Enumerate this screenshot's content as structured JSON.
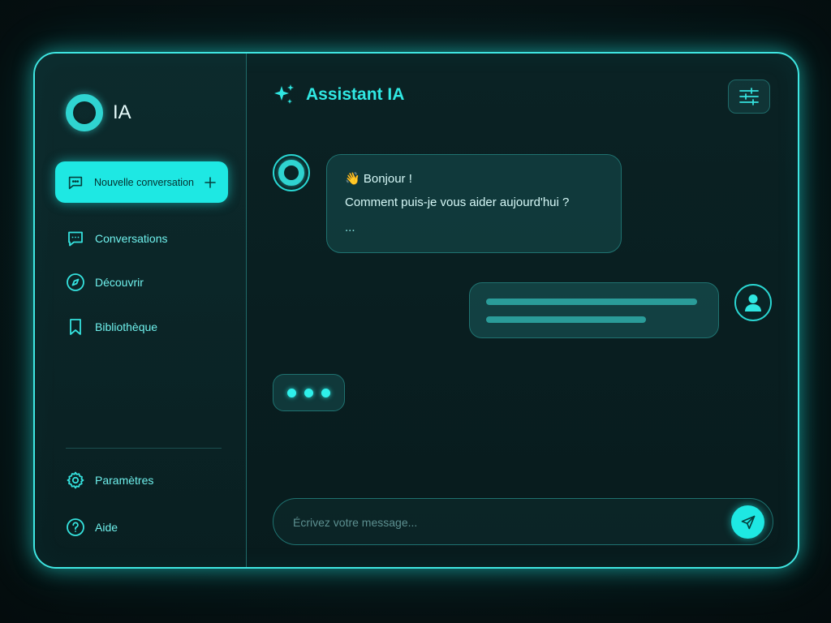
{
  "sidebar": {
    "brand_name": "IA",
    "new_chat_label": "Nouvelle conversation",
    "nav": {
      "conversations": "Conversations",
      "discover": "Découvrir",
      "library": "Bibliothèque",
      "settings": "Paramètres",
      "help": "Aide"
    }
  },
  "header": {
    "title": "Assistant IA"
  },
  "messages": {
    "bot_greeting": "👋 Bonjour !",
    "bot_question": "Comment puis-je vous aider aujourd'hui ?",
    "bot_ellipsis": "..."
  },
  "composer": {
    "placeholder": "Écrivez votre message..."
  },
  "icons": {
    "brand": "ring-logo",
    "new_chat": "chat-bubble-icon",
    "new_chat_add": "plus-icon",
    "conversations": "chat-dots-icon",
    "discover": "compass-icon",
    "library": "bookmark-icon",
    "settings": "gear-icon",
    "help": "question-circle-icon",
    "header": "sparkles-icon",
    "header_settings": "sliders-icon",
    "user_avatar": "user-icon",
    "send": "send-icon"
  },
  "colors": {
    "accent": "#1ee8e3",
    "text_accent": "#6ff0ec",
    "background": "#081b1d"
  }
}
